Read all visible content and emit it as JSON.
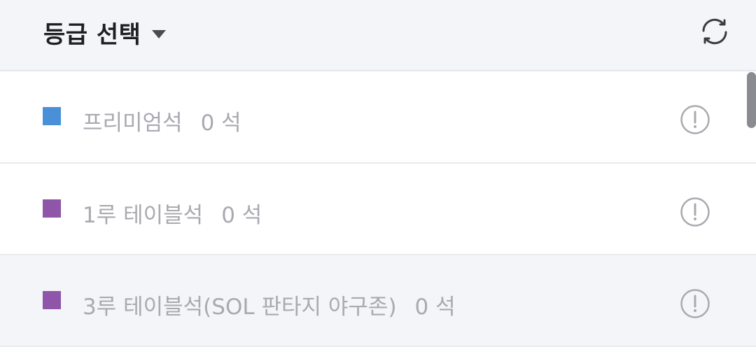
{
  "header": {
    "title": "등급 선택",
    "dropdown_icon": "caret-down-icon",
    "refresh_icon": "refresh-icon"
  },
  "grades": [
    {
      "name": "프리미엄석",
      "count": "0 석",
      "color": "#4a90d9",
      "icon": "info-icon"
    },
    {
      "name": "1루 테이블석",
      "count": "0 석",
      "color": "#8e55a8",
      "icon": "info-icon"
    },
    {
      "name": "3루 테이블석(SOL 판타지 야구존)",
      "count": "0 석",
      "color": "#8e55a8",
      "icon": "info-icon"
    }
  ],
  "colors": {
    "header_bg": "#f4f5f9",
    "row_bg": "#ffffff",
    "text_muted": "#a9aab0",
    "title_text": "#1e1f22"
  }
}
